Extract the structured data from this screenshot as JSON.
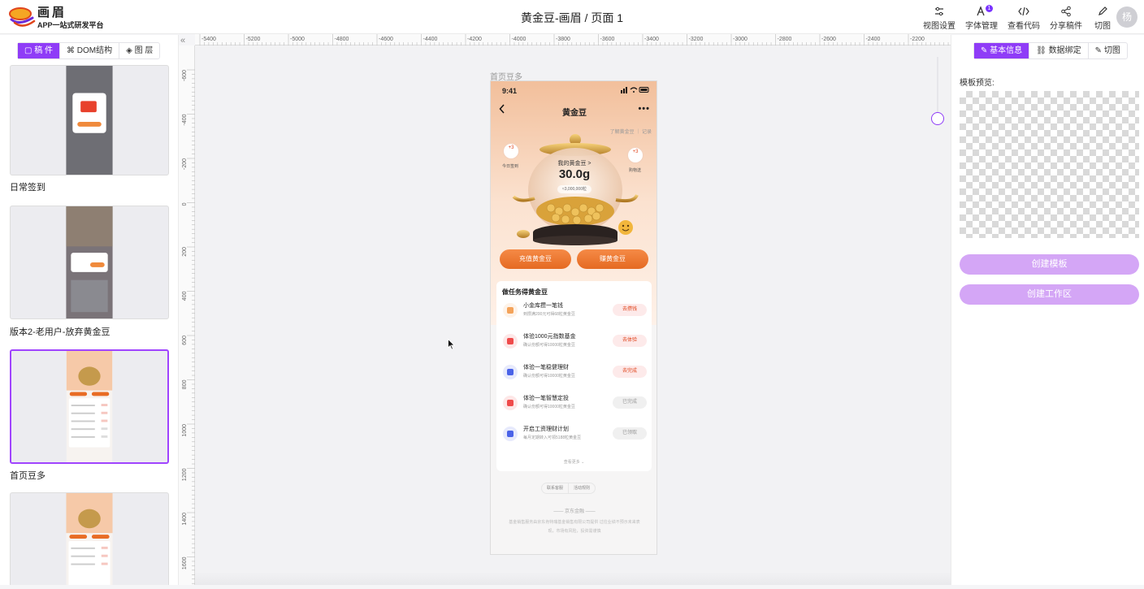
{
  "app": {
    "name": "画眉",
    "subtitle": "APP一站式研发平台"
  },
  "page_title": "黄金豆-画眉 / 页面 1",
  "toolbar": [
    {
      "label": "视图设置",
      "icon": "sliders-icon"
    },
    {
      "label": "字体管理",
      "icon": "font-icon",
      "badge": "1"
    },
    {
      "label": "查看代码",
      "icon": "code-icon"
    },
    {
      "label": "分享稿件",
      "icon": "share-icon"
    },
    {
      "label": "切图",
      "icon": "pen-icon"
    }
  ],
  "user": {
    "avatar_text": "杨"
  },
  "left_tabs": [
    {
      "label": "稿 件",
      "icon": "draft-icon",
      "active": true
    },
    {
      "label": "DOM结构",
      "icon": "dom-icon",
      "active": false
    },
    {
      "label": "图 层",
      "icon": "layers-icon",
      "active": false
    }
  ],
  "pages": [
    {
      "label": "日常签到"
    },
    {
      "label": "版本2-老用户-放弃黄金豆"
    },
    {
      "label": "首页豆多",
      "selected": true
    },
    {
      "label": ""
    }
  ],
  "ruler": {
    "h_ticks": [
      "-5400",
      "-5200",
      "-5000",
      "-4800",
      "-4600",
      "-4400",
      "-4200",
      "-4000",
      "-3800",
      "-3600",
      "-3400",
      "-3200",
      "-3000",
      "-2800",
      "-2600",
      "-2400",
      "-2200"
    ],
    "v_ticks": [
      "-600",
      "-400",
      "-200",
      "0",
      "200",
      "400",
      "600",
      "800",
      "1000",
      "1200",
      "1400",
      "1600"
    ]
  },
  "frame": {
    "label": "首页豆多",
    "status_time": "9:41",
    "nav_title": "黄金豆",
    "more": "•••",
    "learn_text": "了解黄金豆 ｜ 记录",
    "my_bean_label": "我的黄金豆 >",
    "bean_value": "30.0g",
    "bean_sub": "≈3,000,000粒",
    "bubble_left": {
      "plus": "+3",
      "label": "今日签到"
    },
    "bubble_right": {
      "plus": "+3",
      "label": "购物送"
    },
    "btn_recharge": "充值黄金豆",
    "btn_earn": "赚黄金豆",
    "task_title": "做任务得黄金豆",
    "tasks": [
      {
        "name": "小金库攒一笔钱",
        "desc": "到攒满200元可得68粒黄金豆",
        "action": "去攒钱",
        "done": false,
        "color": "#f4a35a"
      },
      {
        "name": "体验1000元指数基金",
        "desc": "确认份额可得10000粒黄金豆",
        "action": "去体验",
        "done": false,
        "color": "#ef4b4b"
      },
      {
        "name": "体验一笔稳健理财",
        "desc": "确认份额可得10000粒黄金豆",
        "action": "去完成",
        "done": false,
        "color": "#4a63e8"
      },
      {
        "name": "体验一笔智慧定投",
        "desc": "确认份额可得10000粒黄金豆",
        "action": "已完成",
        "done": true,
        "color": "#ef4b4b"
      },
      {
        "name": "开启工资理财计划",
        "desc": "每月定期转入可领5188粒黄金豆",
        "action": "已领取",
        "done": true,
        "color": "#4a63e8"
      }
    ],
    "see_more": "查看更多 ⌄",
    "foot_links": [
      "联系客服",
      "活动规则"
    ],
    "foot_brand": "—— 京东金融 ——",
    "foot_disclaimer": "基金销售服务由京东肯特瑞基金销售有限公司提供 过往业绩不预示未来表现，市场有风险，投资需谨慎"
  },
  "right_tabs": [
    {
      "label": "基本信息",
      "icon": "edit-icon",
      "active": true
    },
    {
      "label": "数据绑定",
      "icon": "link-icon",
      "active": false
    },
    {
      "label": "切图",
      "icon": "pen-icon",
      "active": false
    }
  ],
  "template_preview_label": "模板预览:",
  "buttons": {
    "create_template": "创建模板",
    "create_workspace": "创建工作区"
  }
}
